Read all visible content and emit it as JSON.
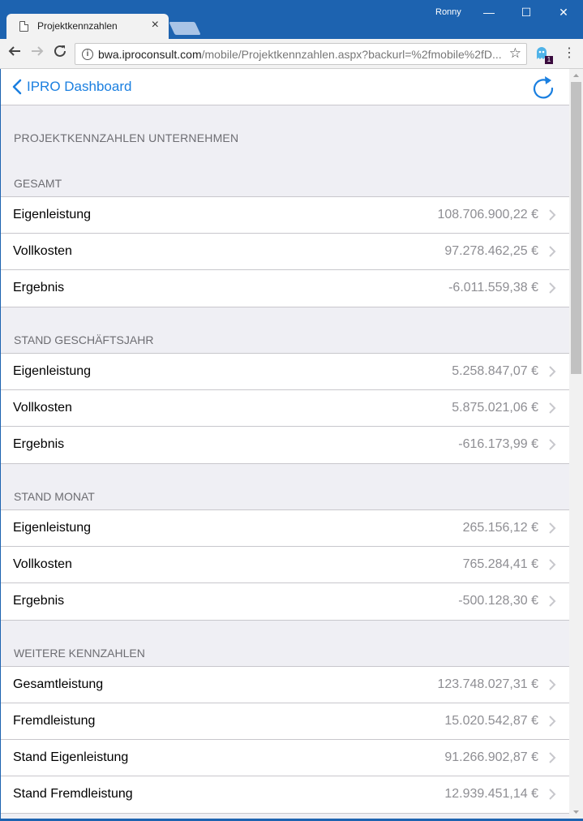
{
  "browser": {
    "tab_title": "Projektkennzahlen",
    "user": "Ronny",
    "url_host": "bwa.iproconsult.com",
    "url_path": "/mobile/Projektkennzahlen.aspx?backurl=%2fmobile%2fD...",
    "extension_badge": "1",
    "icons": [
      "back-arrow-icon",
      "forward-arrow-icon",
      "reload-icon",
      "info-icon",
      "star-icon",
      "menu-dots-icon"
    ]
  },
  "navbar": {
    "back_label": "IPRO Dashboard",
    "accent_color": "#1a7fe0"
  },
  "page_heading": "PROJEKTKENNZAHLEN UNTERNEHMEN",
  "sections": [
    {
      "title": "GESAMT",
      "rows": [
        {
          "label": "Eigenleistung",
          "value": "108.706.900,22 €"
        },
        {
          "label": "Vollkosten",
          "value": "97.278.462,25 €"
        },
        {
          "label": "Ergebnis",
          "value": "-6.011.559,38 €"
        }
      ]
    },
    {
      "title": "STAND GESCHÄFTSJAHR",
      "rows": [
        {
          "label": "Eigenleistung",
          "value": "5.258.847,07 €"
        },
        {
          "label": "Vollkosten",
          "value": "5.875.021,06 €"
        },
        {
          "label": "Ergebnis",
          "value": "-616.173,99 €"
        }
      ]
    },
    {
      "title": "STAND MONAT",
      "rows": [
        {
          "label": "Eigenleistung",
          "value": "265.156,12 €"
        },
        {
          "label": "Vollkosten",
          "value": "765.284,41 €"
        },
        {
          "label": "Ergebnis",
          "value": "-500.128,30 €"
        }
      ]
    },
    {
      "title": "WEITERE KENNZAHLEN",
      "rows": [
        {
          "label": "Gesamtleistung",
          "value": "123.748.027,31 €"
        },
        {
          "label": "Fremdleistung",
          "value": "15.020.542,87 €"
        },
        {
          "label": "Stand Eigenleistung",
          "value": "91.266.902,87 €"
        },
        {
          "label": "Stand Fremdleistung",
          "value": "12.939.451,14 €"
        }
      ]
    }
  ]
}
